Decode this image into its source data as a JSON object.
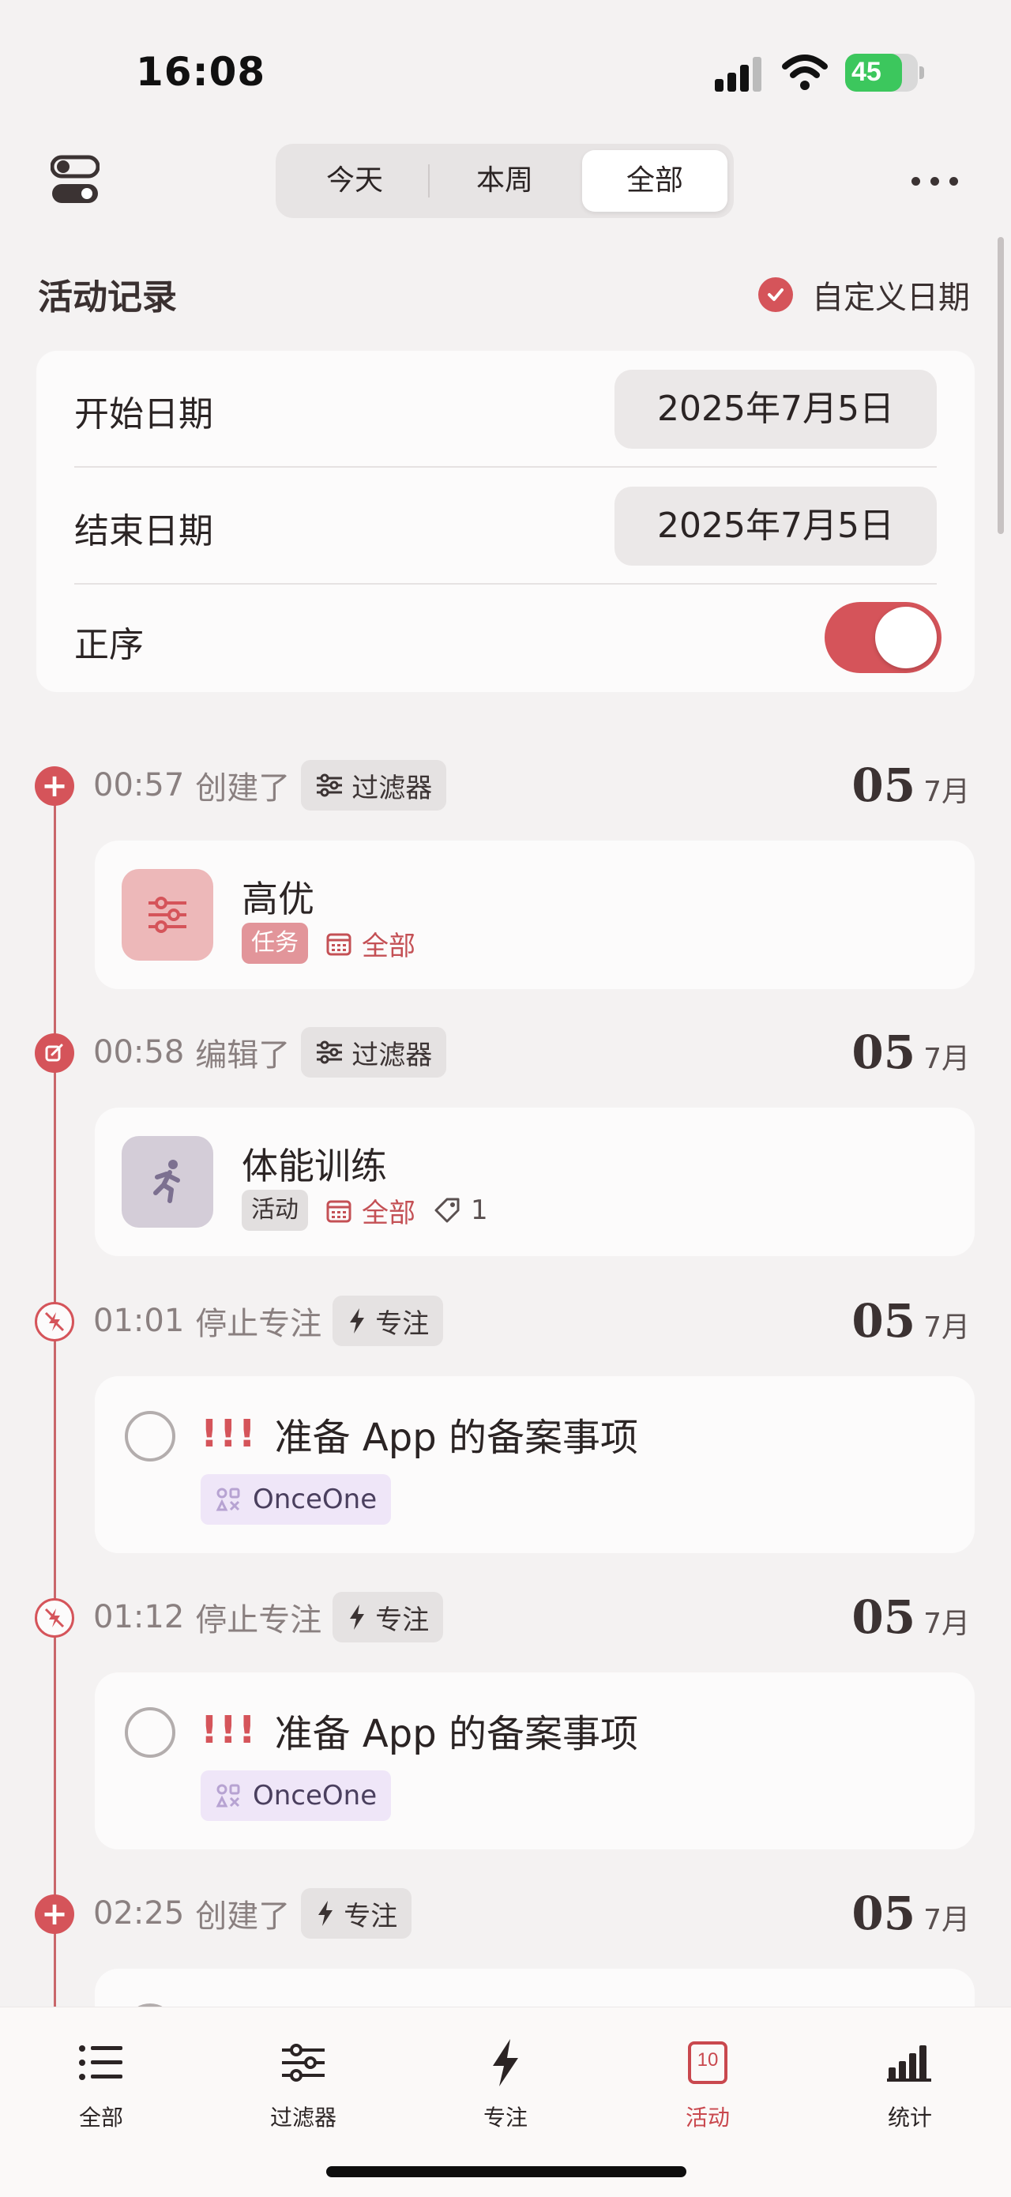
{
  "status_bar": {
    "time": "16:08",
    "battery": "45"
  },
  "header": {
    "segments": [
      "今天",
      "本周",
      "全部"
    ],
    "active_segment": "全部"
  },
  "section": {
    "title": "活动记录",
    "custom_date_label": "自定义日期"
  },
  "settings": {
    "start_label": "开始日期",
    "start_value": "2025年7月5日",
    "end_label": "结束日期",
    "end_value": "2025年7月5日",
    "order_label": "正序",
    "order_on": true
  },
  "events": [
    {
      "time": "00:57",
      "action": "创建了",
      "chip": "过滤器",
      "day": "05",
      "month": "7月",
      "card": {
        "title": "高优",
        "tag": "任务",
        "calendar": "全部"
      }
    },
    {
      "time": "00:58",
      "action": "编辑了",
      "chip": "过滤器",
      "day": "05",
      "month": "7月",
      "card": {
        "title": "体能训练",
        "tag": "活动",
        "calendar": "全部",
        "tag_count": "1"
      }
    },
    {
      "time": "01:01",
      "action": "停止专注",
      "chip": "专注",
      "day": "05",
      "month": "7月",
      "card": {
        "priority": "!!!",
        "title": "准备 App 的备案事项",
        "project": "OnceOne"
      }
    },
    {
      "time": "01:12",
      "action": "停止专注",
      "chip": "专注",
      "day": "05",
      "month": "7月",
      "card": {
        "priority": "!!!",
        "title": "准备 App 的备案事项",
        "project": "OnceOne"
      }
    },
    {
      "time": "02:25",
      "action": "创建了",
      "chip": "专注",
      "day": "05",
      "month": "7月"
    }
  ],
  "tabbar": {
    "items": [
      {
        "label": "全部",
        "icon": "list-icon"
      },
      {
        "label": "过滤器",
        "icon": "sliders-icon"
      },
      {
        "label": "专注",
        "icon": "bolt-icon"
      },
      {
        "label": "活动",
        "icon": "calendar-day-icon",
        "day": "10"
      },
      {
        "label": "统计",
        "icon": "bar-chart-icon"
      }
    ],
    "active": "活动"
  },
  "colors": {
    "accent": "#d5545a",
    "background": "#f4f2f2",
    "card": "#fcfbfb"
  }
}
